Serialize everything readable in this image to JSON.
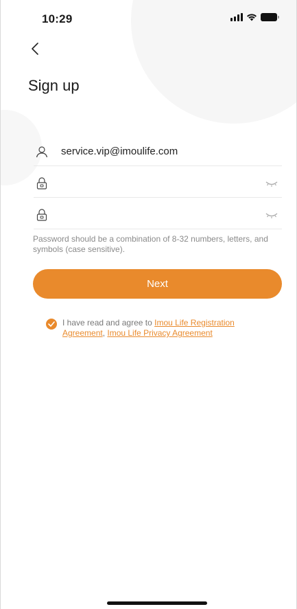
{
  "status_bar": {
    "time": "10:29",
    "signal_icon": "cellular-signal-icon",
    "wifi_icon": "wifi-icon",
    "battery_icon": "battery-icon"
  },
  "nav": {
    "back_icon": "chevron-left-icon"
  },
  "page": {
    "title": "Sign up"
  },
  "form": {
    "email": {
      "icon": "user-icon",
      "value": "service.vip@imoulife.com",
      "placeholder": ""
    },
    "password": {
      "icon": "lock-icon",
      "value": "",
      "placeholder": "",
      "eye_icon": "eye-closed-icon"
    },
    "confirm_password": {
      "icon": "lock-icon",
      "value": "",
      "placeholder": "",
      "eye_icon": "eye-closed-icon"
    },
    "hint": "Password should be a combination of 8-32 numbers, letters, and symbols (case sensitive).",
    "next_label": "Next"
  },
  "agreement": {
    "checked": true,
    "check_icon": "checkmark-circle-icon",
    "prefix": "I have read and agree to ",
    "link1": "Imou Life Registration Agreement",
    "separator": ", ",
    "link2": "Imou Life Privacy Agreement"
  },
  "colors": {
    "accent": "#e98a2c",
    "hint_text": "#8a8a8a",
    "divider": "#e9e9e9"
  }
}
